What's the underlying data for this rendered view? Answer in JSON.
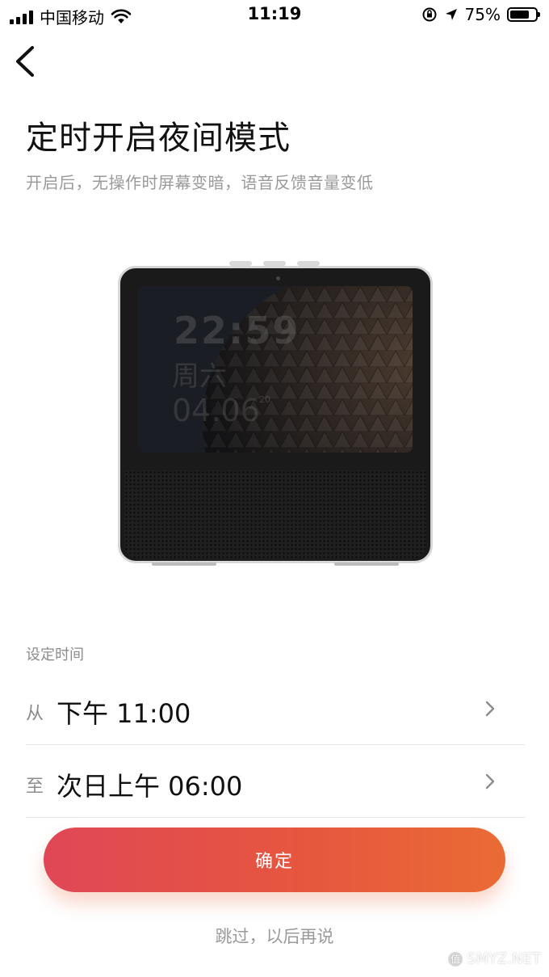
{
  "status_bar": {
    "carrier": "中国移动",
    "time": "11:19",
    "battery_percent": "75%",
    "battery_level": 0.75,
    "icons": [
      "signal-icon",
      "wifi-icon",
      "orientation-lock-icon",
      "location-arrow-icon",
      "battery-icon"
    ]
  },
  "header": {
    "back_icon": "chevron-left-icon",
    "title": "定时开启夜间模式",
    "subtitle": "开启后，无操作时屏幕变暗，语音反馈音量变低"
  },
  "device_image": {
    "screen_time": "22:59",
    "screen_day": "周六",
    "screen_date": "04.06",
    "screen_date_small": "20"
  },
  "schedule": {
    "section_label": "设定时间",
    "from": {
      "prefix": "从",
      "value": "下午 11:00"
    },
    "to": {
      "prefix": "至",
      "value": "次日上午 06:00"
    },
    "chevron_icon": "chevron-right-icon"
  },
  "actions": {
    "confirm_label": "确定",
    "skip_label": "跳过，以后再说"
  },
  "watermark": {
    "badge": "值",
    "text": "SMYZ.NET"
  },
  "colors": {
    "accent_start": "#e04756",
    "accent_end": "#ea6b35",
    "secondary_text": "#9a9a9a"
  }
}
